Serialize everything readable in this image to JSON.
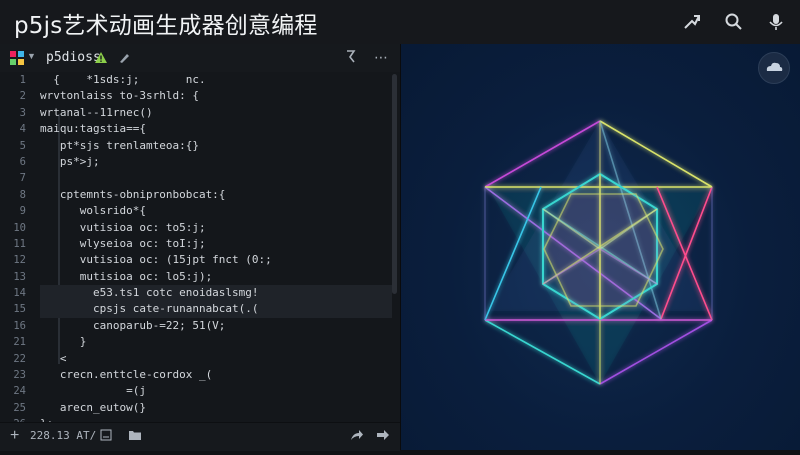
{
  "app": {
    "title": "p5js艺术动画生成器创意编程"
  },
  "toolbar_icons": [
    "share-arrow-icon",
    "search-icon",
    "microphone-icon"
  ],
  "editor": {
    "tab": {
      "name": "p5dioss",
      "warning_icon": "warning-icon",
      "menu_label": "⋯"
    },
    "line_numbers": [
      "1",
      "2",
      "3",
      "4",
      "5",
      "6",
      "7",
      "8",
      "9",
      "10",
      "11",
      "12",
      "13",
      "14",
      "15",
      "16",
      "21",
      "22",
      "23",
      "24",
      "25",
      "26"
    ],
    "lines": [
      "  {    *1sds:j;       nc.",
      "wrvtonlaiss to-3srhld: {",
      "wrtanal--11rnec()",
      "maiqu:tagstia=={",
      "   pt*sjs trenlamteoa:{}",
      "   ps*>j;",
      "",
      "   cptemnts-obnipronbobcat:{",
      "      wolsrido*{",
      "      vutisioa oc: to5:j;",
      "      wlyseioa oc: toI:j;",
      "      vutisioa oc: (15jpt fnct (0:;",
      "      mutisioa oc: lo5:j);",
      "        e53.ts1 cotc enoidaslsmg!",
      "        cpsjs cate-runannabcat(.(",
      "        canoparub-=22; 51(V;",
      "      }",
      "   <",
      "   crecn.enttcle-cordox _(",
      "             =(j",
      "   arecn_eutow(}",
      "};",
      "}"
    ],
    "status": {
      "plus_label": "+",
      "position": "228.13 AT/",
      "icons": [
        "minimize-icon",
        "fullscreen-icon",
        "folder-icon",
        "share-icon",
        "forward-icon"
      ]
    }
  },
  "preview": {
    "shape": "star tetrahedron wireframe",
    "colors": {
      "background": "#0a1e3d",
      "yellow": "#d9e36a",
      "magenta": "#d05ad8",
      "cyan": "#38d6d0",
      "pink": "#ff4d8d"
    }
  }
}
